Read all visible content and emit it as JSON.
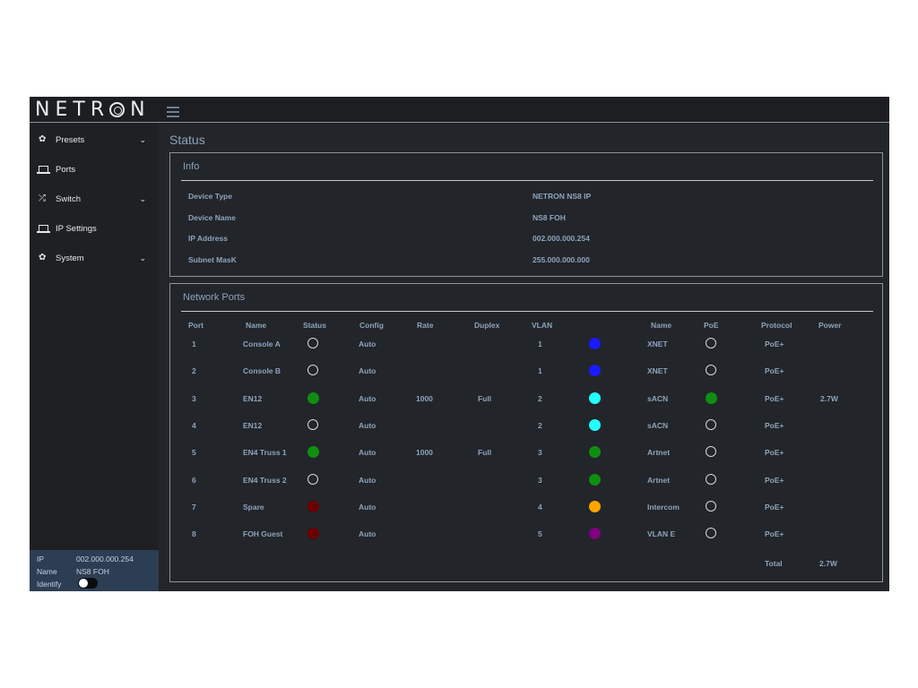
{
  "brand": {
    "logo_text": "NETRON"
  },
  "sidebar": {
    "items": [
      {
        "label": "Presets",
        "icon": "gear-icon",
        "expandable": true
      },
      {
        "label": "Ports",
        "icon": "laptop-icon",
        "expandable": false
      },
      {
        "label": "Switch",
        "icon": "shuffle-icon",
        "expandable": true
      },
      {
        "label": "IP Settings",
        "icon": "laptop-icon",
        "expandable": false
      },
      {
        "label": "System",
        "icon": "gear-icon",
        "expandable": true
      }
    ],
    "footer": {
      "ip_label": "IP",
      "ip_value": "002.000.000.254",
      "name_label": "Name",
      "name_value": "NS8 FOH",
      "identify_label": "Identify",
      "identify_on": false
    }
  },
  "main": {
    "title": "Status",
    "info": {
      "title": "Info",
      "rows": [
        {
          "key": "Device Type",
          "value": "NETRON NS8 IP"
        },
        {
          "key": "Device Name",
          "value": "NS8 FOH"
        },
        {
          "key": "IP Address",
          "value": "002.000.000.254"
        },
        {
          "key": "Subnet MasK",
          "value": "255.000.000.000"
        }
      ]
    },
    "ports": {
      "title": "Network Ports",
      "headers": [
        "Port",
        "Name",
        "Status",
        "Config",
        "Rate",
        "Duplex",
        "VLAN",
        "Name",
        "PoE",
        "Protocol",
        "Power"
      ],
      "rows": [
        {
          "port": "1",
          "name": "Console A",
          "status": "off",
          "config": "Auto",
          "rate": "",
          "duplex": "",
          "vlan": "1",
          "vlan_color": "#1a1aff",
          "vlan_name": "XNET",
          "poe": "off",
          "protocol": "PoE+",
          "power": ""
        },
        {
          "port": "2",
          "name": "Console B",
          "status": "off",
          "config": "Auto",
          "rate": "",
          "duplex": "",
          "vlan": "1",
          "vlan_color": "#1a1aff",
          "vlan_name": "XNET",
          "poe": "off",
          "protocol": "PoE+",
          "power": ""
        },
        {
          "port": "3",
          "name": "EN12",
          "status": "up",
          "config": "Auto",
          "rate": "1000",
          "duplex": "Full",
          "vlan": "2",
          "vlan_color": "#22ffff",
          "vlan_name": "sACN",
          "poe": "on",
          "protocol": "PoE+",
          "power": "2.7W"
        },
        {
          "port": "4",
          "name": "EN12",
          "status": "off",
          "config": "Auto",
          "rate": "",
          "duplex": "",
          "vlan": "2",
          "vlan_color": "#22ffff",
          "vlan_name": "sACN",
          "poe": "off",
          "protocol": "PoE+",
          "power": ""
        },
        {
          "port": "5",
          "name": "EN4 Truss 1",
          "status": "up",
          "config": "Auto",
          "rate": "1000",
          "duplex": "Full",
          "vlan": "3",
          "vlan_color": "#0f8f0f",
          "vlan_name": "Artnet",
          "poe": "off",
          "protocol": "PoE+",
          "power": ""
        },
        {
          "port": "6",
          "name": "EN4 Truss 2",
          "status": "off",
          "config": "Auto",
          "rate": "",
          "duplex": "",
          "vlan": "3",
          "vlan_color": "#0f8f0f",
          "vlan_name": "Artnet",
          "poe": "off",
          "protocol": "PoE+",
          "power": ""
        },
        {
          "port": "7",
          "name": "Spare",
          "status": "disabled",
          "config": "Auto",
          "rate": "",
          "duplex": "",
          "vlan": "4",
          "vlan_color": "#ffa500",
          "vlan_name": "Intercom",
          "poe": "off",
          "protocol": "PoE+",
          "power": ""
        },
        {
          "port": "8",
          "name": "FOH Guest",
          "status": "disabled",
          "config": "Auto",
          "rate": "",
          "duplex": "",
          "vlan": "5",
          "vlan_color": "#800080",
          "vlan_name": "VLAN E",
          "poe": "off",
          "protocol": "PoE+",
          "power": ""
        }
      ],
      "total_label": "Total",
      "total_power": "2.7W"
    }
  },
  "colors": {
    "status_up": "#0f8f0f",
    "status_disabled": "#6b0000",
    "poe_on": "#0f8f0f",
    "text_label": "#8ea4bc",
    "background": "#22252a"
  }
}
